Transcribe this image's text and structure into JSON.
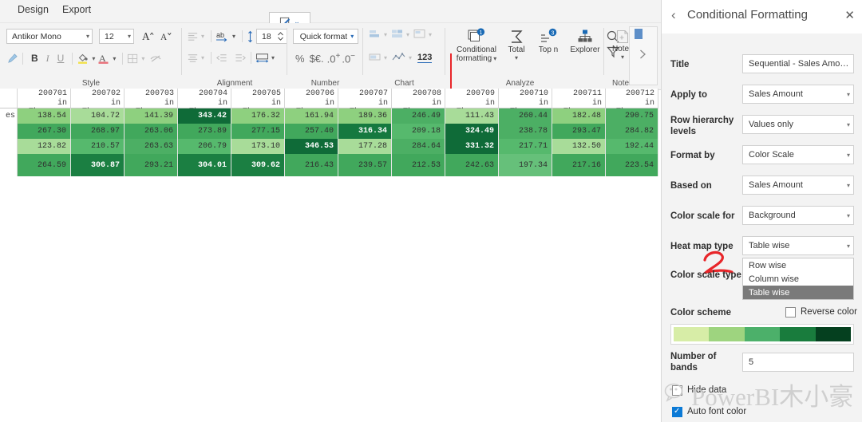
{
  "menu": {
    "items": [
      {
        "label": "t",
        "name": "menu-item-truncated"
      },
      {
        "label": "Design",
        "name": "menu-item-design"
      },
      {
        "label": "Export",
        "name": "menu-item-export"
      }
    ],
    "pen_icon": "pen-edit-icon",
    "pen_chevron": "⌄"
  },
  "ribbon": {
    "groups": [
      {
        "label": "Style"
      },
      {
        "label": "Alignment"
      },
      {
        "label": "Number"
      },
      {
        "label": "Chart"
      },
      {
        "label": "Analyze"
      },
      {
        "label": "Notes"
      }
    ],
    "style": {
      "font_family_value": "Antikor Mono",
      "font_size_value": "12",
      "grow_font_icon": "increase-font-size-icon",
      "shrink_font_icon": "decrease-font-size-icon",
      "format_painter_icon": "format-painter-icon",
      "bold_label": "B",
      "italic_label": "I",
      "underline_label": "U",
      "fill_color_icon": "fill-color-icon",
      "font_color_icon": "font-color-icon",
      "borders_icon": "borders-icon",
      "hide_icon": "hide-eye-icon"
    },
    "alignment": {
      "align_horizontal_icon": "align-horizontal-icon",
      "wrap_text_icon": "wrap-text-icon",
      "line_height_icon": "line-height-icon",
      "line_height_value": "18",
      "align_vertical_icon": "align-vertical-icon",
      "decrease_indent_icon": "decrease-indent-icon",
      "increase_indent_icon": "increase-indent-icon",
      "column_width_icon": "column-width-icon"
    },
    "number": {
      "quick_format_label": "Quick format",
      "percent_label": "%",
      "currency_label": "$€.",
      "inc_decimal_label": ".0",
      "dec_decimal_label": ".0"
    },
    "chart": {
      "bar_chart_icon": "bar-chart-icon",
      "stacked_chart_icon": "stacked-chart-icon",
      "variance_chart_icon": "variance-chart-icon",
      "in_cell_bar_icon": "in-cell-bar-icon",
      "line_chart_icon": "line-chart-icon",
      "number_123_label": "123"
    },
    "analyze": {
      "conditional_formatting_label_l1": "Conditional",
      "conditional_formatting_label_l2": "formatting",
      "conditional_formatting_icon": "conditional-formatting-icon",
      "conditional_formatting_badge": "1",
      "total_label": "Total",
      "total_icon": "sigma-icon",
      "topn_label": "Top n",
      "topn_icon": "top-n-icon",
      "topn_badge": "3",
      "explorer_label": "Explorer",
      "explorer_icon": "explorer-icon",
      "search_icon": "search-icon",
      "filter_icon": "filter-icon"
    },
    "notes": {
      "notes_label": "Notes",
      "notes_icon": "add-note-icon"
    },
    "overflow": {
      "more_icon": "chevron-right-icon"
    }
  },
  "table": {
    "row_header_text": "es",
    "column_headers": [
      {
        "line1": "200701",
        "line2": "in Thousan…"
      },
      {
        "line1": "200702",
        "line2": "in Thousan…"
      },
      {
        "line1": "200703",
        "line2": "in Thousan…"
      },
      {
        "line1": "200704",
        "line2": "in Thousan…"
      },
      {
        "line1": "200705",
        "line2": "in Thousan…"
      },
      {
        "line1": "200706",
        "line2": "in Thousan…"
      },
      {
        "line1": "200707",
        "line2": "in Thousan…"
      },
      {
        "line1": "200708",
        "line2": "in Thousan…"
      },
      {
        "line1": "200709",
        "line2": "in Thousan…"
      },
      {
        "line1": "200710",
        "line2": "in Thousan…"
      },
      {
        "line1": "200711",
        "line2": "in Thousan…"
      },
      {
        "line1": "200712",
        "line2": "in Thousan…"
      }
    ],
    "rows": [
      {
        "cells": [
          {
            "v": "138.54",
            "bg": "#8ed07f",
            "fg": "#2f2f2f"
          },
          {
            "v": "104.72",
            "bg": "#a8dc99",
            "fg": "#2f2f2f"
          },
          {
            "v": "141.39",
            "bg": "#8ed07f",
            "fg": "#2f2f2f"
          },
          {
            "v": "343.42",
            "bg": "#0f6b38",
            "fg": "#ffffff"
          },
          {
            "v": "176.32",
            "bg": "#8ed07f",
            "fg": "#2f2f2f"
          },
          {
            "v": "161.94",
            "bg": "#8ed07f",
            "fg": "#2f2f2f"
          },
          {
            "v": "189.36",
            "bg": "#8ed07f",
            "fg": "#2f2f2f"
          },
          {
            "v": "246.49",
            "bg": "#4caf64",
            "fg": "#2f2f2f"
          },
          {
            "v": "111.43",
            "bg": "#a8dc99",
            "fg": "#2f2f2f"
          },
          {
            "v": "260.44",
            "bg": "#4caf64",
            "fg": "#2f2f2f"
          },
          {
            "v": "182.48",
            "bg": "#8ed07f",
            "fg": "#2f2f2f"
          },
          {
            "v": "290.75",
            "bg": "#4caf64",
            "fg": "#2f2f2f"
          }
        ]
      },
      {
        "cells": [
          {
            "v": "267.30",
            "bg": "#41a85c",
            "fg": "#2f2f2f"
          },
          {
            "v": "268.97",
            "bg": "#41a85c",
            "fg": "#2f2f2f"
          },
          {
            "v": "263.06",
            "bg": "#41a85c",
            "fg": "#2f2f2f"
          },
          {
            "v": "273.89",
            "bg": "#41a85c",
            "fg": "#2f2f2f"
          },
          {
            "v": "277.15",
            "bg": "#41a85c",
            "fg": "#2f2f2f"
          },
          {
            "v": "257.40",
            "bg": "#41a85c",
            "fg": "#2f2f2f"
          },
          {
            "v": "316.34",
            "bg": "#15793f",
            "fg": "#ffffff"
          },
          {
            "v": "209.18",
            "bg": "#56b96d",
            "fg": "#2f2f2f"
          },
          {
            "v": "324.49",
            "bg": "#0f6b38",
            "fg": "#ffffff"
          },
          {
            "v": "238.78",
            "bg": "#4caf64",
            "fg": "#2f2f2f"
          },
          {
            "v": "293.47",
            "bg": "#41a85c",
            "fg": "#2f2f2f"
          },
          {
            "v": "284.82",
            "bg": "#4caf64",
            "fg": "#2f2f2f"
          }
        ]
      },
      {
        "cells": [
          {
            "v": "123.82",
            "bg": "#a8dc99",
            "fg": "#2f2f2f"
          },
          {
            "v": "210.57",
            "bg": "#56b96d",
            "fg": "#2f2f2f"
          },
          {
            "v": "263.63",
            "bg": "#4caf64",
            "fg": "#2f2f2f"
          },
          {
            "v": "206.79",
            "bg": "#56b96d",
            "fg": "#2f2f2f"
          },
          {
            "v": "173.10",
            "bg": "#a8dc99",
            "fg": "#2f2f2f"
          },
          {
            "v": "346.53",
            "bg": "#0f6b38",
            "fg": "#ffffff"
          },
          {
            "v": "177.28",
            "bg": "#a8dc99",
            "fg": "#2f2f2f"
          },
          {
            "v": "284.64",
            "bg": "#4caf64",
            "fg": "#2f2f2f"
          },
          {
            "v": "331.32",
            "bg": "#0f6b38",
            "fg": "#ffffff"
          },
          {
            "v": "217.71",
            "bg": "#56b96d",
            "fg": "#2f2f2f"
          },
          {
            "v": "132.50",
            "bg": "#a8dc99",
            "fg": "#2f2f2f"
          },
          {
            "v": "192.44",
            "bg": "#56b96d",
            "fg": "#2f2f2f"
          }
        ]
      },
      {
        "cells": [
          {
            "v": "264.59",
            "bg": "#41a85c",
            "fg": "#2f2f2f"
          },
          {
            "v": "306.87",
            "bg": "#1b7f42",
            "fg": "#ffffff"
          },
          {
            "v": "293.21",
            "bg": "#41a85c",
            "fg": "#2f2f2f"
          },
          {
            "v": "304.01",
            "bg": "#1b7f42",
            "fg": "#ffffff"
          },
          {
            "v": "309.62",
            "bg": "#1b7f42",
            "fg": "#ffffff"
          },
          {
            "v": "216.43",
            "bg": "#41a85c",
            "fg": "#2f2f2f"
          },
          {
            "v": "239.57",
            "bg": "#41a85c",
            "fg": "#2f2f2f"
          },
          {
            "v": "212.53",
            "bg": "#41a85c",
            "fg": "#2f2f2f"
          },
          {
            "v": "242.63",
            "bg": "#41a85c",
            "fg": "#2f2f2f"
          },
          {
            "v": "197.34",
            "bg": "#66c07a",
            "fg": "#2f2f2f"
          },
          {
            "v": "217.16",
            "bg": "#41a85c",
            "fg": "#2f2f2f"
          },
          {
            "v": "223.54",
            "bg": "#41a85c",
            "fg": "#2f2f2f"
          }
        ]
      }
    ]
  },
  "panel": {
    "title": "Conditional Formatting",
    "back_icon": "chevron-left-icon",
    "close_icon": "close-icon",
    "fields": [
      {
        "label": "Title",
        "value": "Sequential - Sales Amo…",
        "type": "text",
        "name": "title-field"
      },
      {
        "label": "Apply to",
        "value": "Sales Amount",
        "type": "select",
        "name": "apply-to-select"
      },
      {
        "label": "Row hierarchy levels",
        "value": "Values only",
        "type": "select",
        "name": "row-hierarchy-levels-select"
      },
      {
        "label": "Format by",
        "value": "Color Scale",
        "type": "select",
        "name": "format-by-select"
      },
      {
        "label": "Based on",
        "value": "Sales Amount",
        "type": "select",
        "name": "based-on-select"
      },
      {
        "label": "Color scale for",
        "value": "Background",
        "type": "select",
        "name": "color-scale-for-select"
      },
      {
        "label": "Heat map type",
        "value": "Table wise",
        "type": "select",
        "name": "heat-map-type-select"
      }
    ],
    "color_scale_type": {
      "label": "Color scale type",
      "options": [
        "Row wise",
        "Column wise",
        "Table wise"
      ],
      "selected": "Table wise"
    },
    "color_scheme": {
      "label": "Color scheme",
      "reverse_label": "Reverse color",
      "reverse_checked": false,
      "swatches": [
        "#d7eda7",
        "#9ed47f",
        "#4cb06a",
        "#197c3d",
        "#05401f"
      ]
    },
    "number_of_bands": {
      "label_l1": "Number of",
      "label_l2": "bands",
      "value": "5"
    },
    "hide_label": "Hide data",
    "auto_font_color": {
      "label": "Auto font color",
      "checked": true
    }
  },
  "watermark": {
    "text": "PowerBI木小豪",
    "icon": "wechat-icon"
  }
}
